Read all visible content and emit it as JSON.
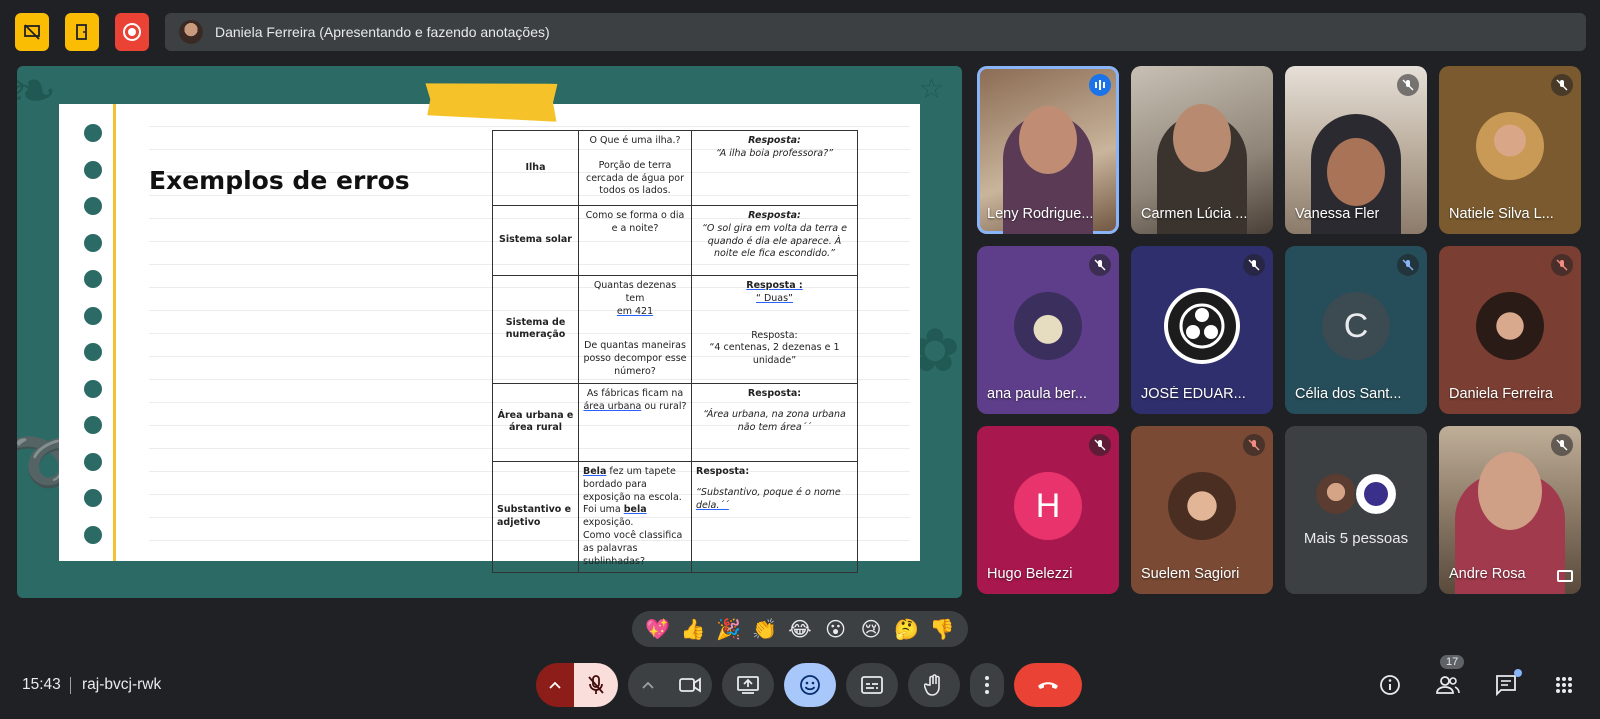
{
  "topbar": {
    "presenter_text": "Daniela Ferreira (Apresentando e fazendo anotações)",
    "icons": [
      "no-screen-icon",
      "door-exit-icon",
      "record-icon"
    ]
  },
  "slide": {
    "title": "Exemplos de erros",
    "rows": [
      {
        "topic": "Ilha",
        "question_lines": [
          "O Que é uma ilha.?",
          "",
          "Porção de terra cercada de água por todos os lados."
        ],
        "answer_heading": "Resposta:",
        "answer": "“A ilha boia professora?”"
      },
      {
        "topic": "Sistema solar",
        "question_lines": [
          "Como se forma o dia e a noite?"
        ],
        "answer_heading": "Resposta:",
        "answer": "“O sol gira em volta da terra e quando é dia ele aparece. À noite ele fica escondido.”"
      },
      {
        "topic": "Sistema de numeração",
        "question_a": "Quantas dezenas tem",
        "question_a_ul": "em 421",
        "question_b": "De quantas maneiras posso decompor esse número?",
        "answer_heading": "Resposta :",
        "answer_a": "“ Duas”",
        "answer_b_heading": "Resposta:",
        "answer_b": "“4 centenas, 2 dezenas e 1 unidade”"
      },
      {
        "topic": "Área urbana e área rural",
        "question_pre": "As fábricas ficam na",
        "question_ul": "área urbana",
        "question_post": "ou rural?",
        "answer_heading": "Resposta:",
        "answer": "“Área urbana, na zona urbana não tem área´´"
      },
      {
        "topic": "Substantivo e adjetivo",
        "question_w1": "Bela",
        "question_t1": "fez um tapete bordado para exposição na escola. Foi uma",
        "question_w2": "bela",
        "question_t2": "exposição.",
        "question_t3": "Como você classifica as palavras sublinhadas?",
        "answer_heading": "Resposta:",
        "answer_pre": "“Substantivo, poque é o nome",
        "answer_ul": "dela.´´"
      }
    ]
  },
  "participants": [
    {
      "name": "Leny Rodrigue...",
      "status": "speaking"
    },
    {
      "name": "Carmen Lúcia ...",
      "status": "none"
    },
    {
      "name": "Vanessa Fler",
      "status": "muted"
    },
    {
      "name": "Natiele Silva L...",
      "status": "muted"
    },
    {
      "name": "ana paula ber...",
      "status": "muted"
    },
    {
      "name": "JOSÉ EDUAR...",
      "status": "muted"
    },
    {
      "name": "Célia dos Sant...",
      "status": "muted",
      "initial": "C"
    },
    {
      "name": "Daniela Ferreira",
      "status": "muted"
    },
    {
      "name": "Hugo Belezzi",
      "status": "muted",
      "initial": "H"
    },
    {
      "name": "Suelem Sagiori",
      "status": "muted"
    },
    {
      "name": "Mais 5 pessoas",
      "status": "none"
    },
    {
      "name": "Andre Rosa",
      "status": "muted"
    }
  ],
  "reactions": [
    "💖",
    "👍",
    "🎉",
    "👏",
    "😂",
    "😮",
    "😢",
    "🤔",
    "👎"
  ],
  "bottom": {
    "time": "15:43",
    "meeting_code": "raj-bvcj-rwk",
    "people_count": "17"
  },
  "colors": {
    "accent_yellow": "#fbbc04",
    "end_red": "#ea4335",
    "speaking_blue": "#8ab4f8",
    "slide_bg": "#2c6b65"
  }
}
